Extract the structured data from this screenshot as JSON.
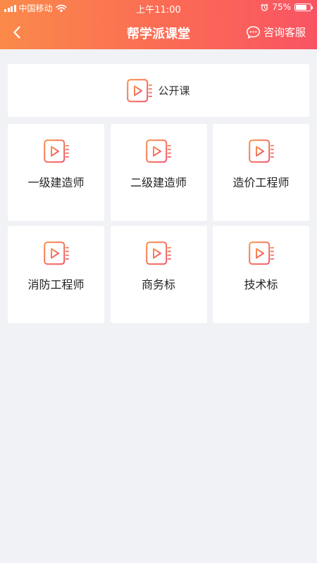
{
  "status_bar": {
    "carrier": "中国移动",
    "time": "上午11:00",
    "battery_percent": "75%",
    "battery_level": 0.75,
    "icons": [
      "signal-icon",
      "wifi-icon",
      "alarm-icon",
      "battery-icon"
    ]
  },
  "nav": {
    "title": "帮学派课堂",
    "back_icon": "chevron-left-icon",
    "consult_label": "咨询客服",
    "consult_icon": "chat-bubble-icon"
  },
  "public_course": {
    "label": "公开课",
    "icon": "video-play-icon"
  },
  "categories": [
    {
      "label": "一级建造师",
      "icon": "video-play-icon"
    },
    {
      "label": "二级建造师",
      "icon": "video-play-icon"
    },
    {
      "label": "造价工程师",
      "icon": "video-play-icon"
    },
    {
      "label": "消防工程师",
      "icon": "video-play-icon"
    },
    {
      "label": "商务标",
      "icon": "video-play-icon"
    },
    {
      "label": "技术标",
      "icon": "video-play-icon"
    }
  ],
  "colors": {
    "header_gradient_start": "#fb8a4a",
    "header_gradient_end": "#f95463",
    "icon_gradient_start": "#f8924d",
    "icon_gradient_end": "#f2546a",
    "page_background": "#f1f2f6"
  }
}
